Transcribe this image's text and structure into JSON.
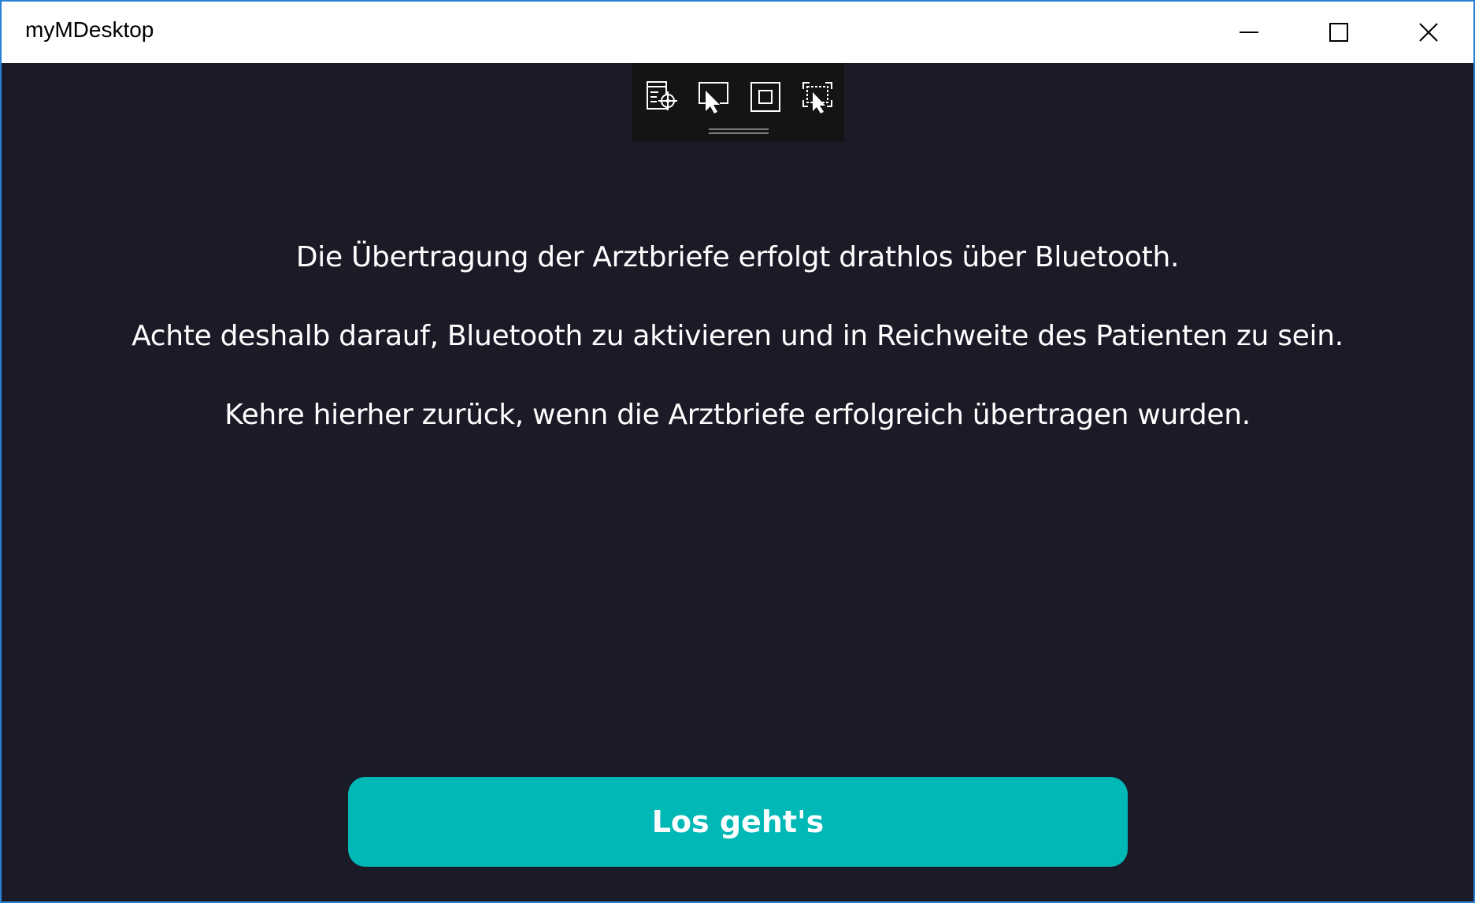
{
  "window": {
    "title": "myMDesktop",
    "controls": {
      "minimize_icon": "minimize-icon",
      "maximize_icon": "maximize-icon",
      "close_icon": "close-icon"
    }
  },
  "dev_toolbar": {
    "tools": [
      {
        "icon": "live-visual-tree-icon"
      },
      {
        "icon": "select-element-icon"
      },
      {
        "icon": "display-layout-adorners-icon"
      },
      {
        "icon": "track-focused-element-icon"
      }
    ]
  },
  "main": {
    "messages": [
      "Die Übertragung der Arztbriefe erfolgt drathlos über Bluetooth.",
      "Achte deshalb darauf, Bluetooth zu aktivieren und in Reichweite des Patienten zu sein.",
      "Kehre hierher zurück, wenn die Arztbriefe erfolgreich übertragen wurden."
    ],
    "cta_label": "Los geht's"
  },
  "colors": {
    "background": "#1b1b28",
    "accent": "#00b8b6",
    "titlebar": "#ffffff",
    "window_border": "#2b7fd4"
  }
}
